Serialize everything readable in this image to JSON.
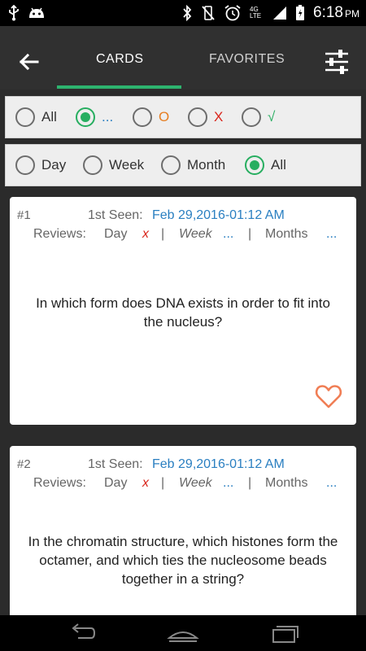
{
  "status_bar": {
    "time": "6:18",
    "ampm": "PM",
    "network": "4G LTE",
    "icons": [
      "usb-icon",
      "android-icon",
      "bluetooth-icon",
      "vibrate-icon",
      "alarm-icon",
      "signal-icon",
      "battery-icon"
    ]
  },
  "app_bar": {
    "back_icon": "arrow-left-icon",
    "tabs": [
      {
        "label": "CARDS",
        "active": true
      },
      {
        "label": "FAVORITES",
        "active": false
      }
    ],
    "filter_icon": "sliders-icon",
    "accent_color": "#2db36e"
  },
  "filter_status": {
    "options": [
      {
        "label": "All",
        "checked": false,
        "color": "#333333"
      },
      {
        "label": "...",
        "checked": true,
        "color": "#2a7fc1"
      },
      {
        "label": "O",
        "checked": false,
        "color": "#e67e22"
      },
      {
        "label": "X",
        "checked": false,
        "color": "#d9261c"
      },
      {
        "label": "√",
        "checked": false,
        "color": "#27ae60"
      }
    ]
  },
  "filter_period": {
    "options": [
      {
        "label": "Day",
        "checked": false
      },
      {
        "label": "Week",
        "checked": false
      },
      {
        "label": "Month",
        "checked": false
      },
      {
        "label": "All",
        "checked": true
      }
    ]
  },
  "cards": [
    {
      "number": "#1",
      "seen_label": "1st Seen:",
      "seen_value": "Feb 29,2016-01:12 AM",
      "reviews_label": "Reviews:",
      "day_label": "Day",
      "day_value": "x",
      "sep1": "|",
      "week_label": "Week",
      "week_value": "...",
      "sep2": "|",
      "months_label": "Months",
      "months_value": "...",
      "question": "In which form does DNA exists in order to fit into the nucleus?",
      "favorite_icon": "heart-outline-icon"
    },
    {
      "number": "#2",
      "seen_label": "1st Seen:",
      "seen_value": "Feb 29,2016-01:12 AM",
      "reviews_label": "Reviews:",
      "day_label": "Day",
      "day_value": "x",
      "sep1": "|",
      "week_label": "Week",
      "week_value": "...",
      "sep2": "|",
      "months_label": "Months",
      "months_value": "...",
      "question": "In the chromatin structure, which histones form the octamer, and which ties the nucleosome beads together in a string?"
    }
  ],
  "nav_bar": {
    "icons": [
      "back-nav-icon",
      "home-nav-icon",
      "recents-nav-icon"
    ]
  }
}
